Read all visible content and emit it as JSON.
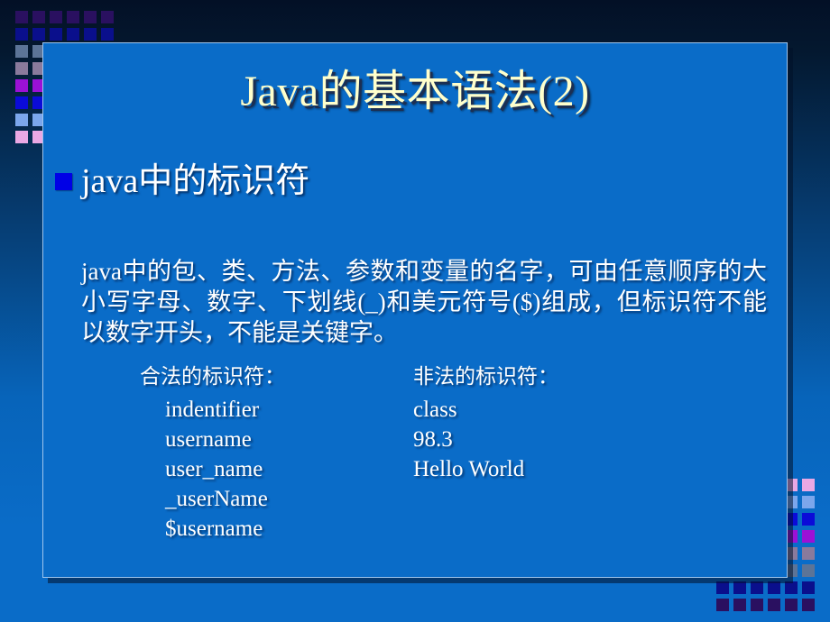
{
  "slide": {
    "title": "Java的基本语法(2)",
    "title_color": "#ffffcc",
    "frame_color": "#0a6cc8",
    "frame_border_color": "#9fc6ee",
    "background_top_color": "#031026",
    "background_bottom_color": "#0a6cc8"
  },
  "bullet": {
    "marker_color": "#0000e6",
    "label": "java中的标识符"
  },
  "body": {
    "paragraph": "java中的包、类、方法、参数和变量的名字，可由任意顺序的大小写字母、数字、下划线(_)和美元符号($)组成，但标识符不能以数字开头，不能是关键字。"
  },
  "examples": {
    "legal": {
      "heading": "合法的标识符：",
      "items": [
        "indentifier",
        "username",
        "user_name",
        "_userName",
        "$username"
      ]
    },
    "illegal": {
      "heading": "非法的标识符：",
      "items": [
        "class",
        "98.3",
        "Hello World"
      ]
    }
  },
  "decoration": {
    "palette": {
      "dark_purple": "#2a1060",
      "dark_blue": "#0a0f8c",
      "slate": "#5c7497",
      "mauve": "#8a7a9c",
      "purple": "#9b11d6",
      "blue": "#0b0bd8",
      "light_blue": "#7ba6ec",
      "pink": "#eaa8e4"
    },
    "top_left_rows": [
      [
        "dark_purple",
        "dark_purple",
        "dark_purple",
        "dark_purple",
        "dark_purple",
        "dark_purple"
      ],
      [
        "dark_blue",
        "dark_blue",
        "dark_blue",
        "dark_blue",
        "dark_blue",
        "dark_blue"
      ]
    ],
    "left_rows": [
      [
        "slate",
        "slate"
      ],
      [
        "mauve",
        "mauve"
      ],
      [
        "purple",
        "purple"
      ],
      [
        "blue",
        "blue"
      ],
      [
        "light_blue",
        "light_blue"
      ],
      [
        "pink",
        "pink"
      ]
    ],
    "bottom_right_rows": [
      [
        "dark_blue",
        "dark_blue",
        "dark_blue",
        "dark_blue",
        "dark_blue",
        "dark_blue"
      ],
      [
        "dark_purple",
        "dark_purple",
        "dark_purple",
        "dark_purple",
        "dark_purple",
        "dark_purple"
      ]
    ],
    "right_rows": [
      [
        "pink",
        "pink"
      ],
      [
        "light_blue",
        "light_blue"
      ],
      [
        "blue",
        "blue"
      ],
      [
        "purple",
        "purple"
      ],
      [
        "mauve",
        "mauve"
      ],
      [
        "slate",
        "slate"
      ]
    ]
  }
}
